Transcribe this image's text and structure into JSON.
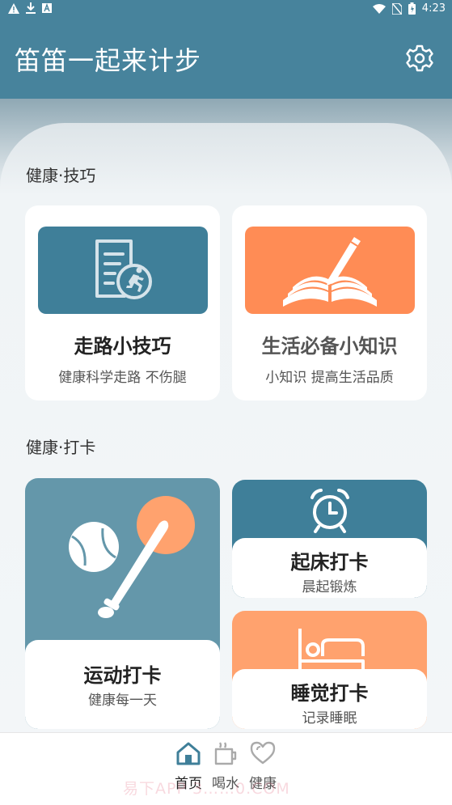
{
  "status_bar": {
    "time": "4:23"
  },
  "app_bar": {
    "title": "笛笛一起来计步",
    "settings_icon": "gear-icon"
  },
  "sections": {
    "tips_title": "健康·技巧",
    "checkin_title": "健康·打卡"
  },
  "tips": [
    {
      "title": "走路小技巧",
      "subtitle": "健康科学走路 不伤腿",
      "icon": "document-runner-icon",
      "color": "#3f7f99"
    },
    {
      "title": "生活必备小知识",
      "subtitle": "小知识 提高生活品质",
      "icon": "open-book-pen-icon",
      "color": "#ff8c55"
    }
  ],
  "checkins": {
    "sport": {
      "title": "运动打卡",
      "subtitle": "健康每一天",
      "icon": "baseball-bat-icon",
      "color": "#6497aa"
    },
    "wake": {
      "title": "起床打卡",
      "subtitle": "晨起锻炼",
      "icon": "alarm-clock-icon",
      "color": "#3f7f99"
    },
    "sleep": {
      "title": "睡觉打卡",
      "subtitle": "记录睡眠",
      "icon": "bed-icon",
      "color": "#ffa26e"
    }
  },
  "nav": [
    {
      "label": "首页",
      "icon": "home-icon",
      "active": true
    },
    {
      "label": "喝水",
      "icon": "cup-icon",
      "active": false
    },
    {
      "label": "健康",
      "icon": "heart-icon",
      "active": false
    }
  ],
  "colors": {
    "primary": "#47839c",
    "accent_orange": "#ff8c55"
  },
  "watermark": "易下APP 3……0.COM"
}
